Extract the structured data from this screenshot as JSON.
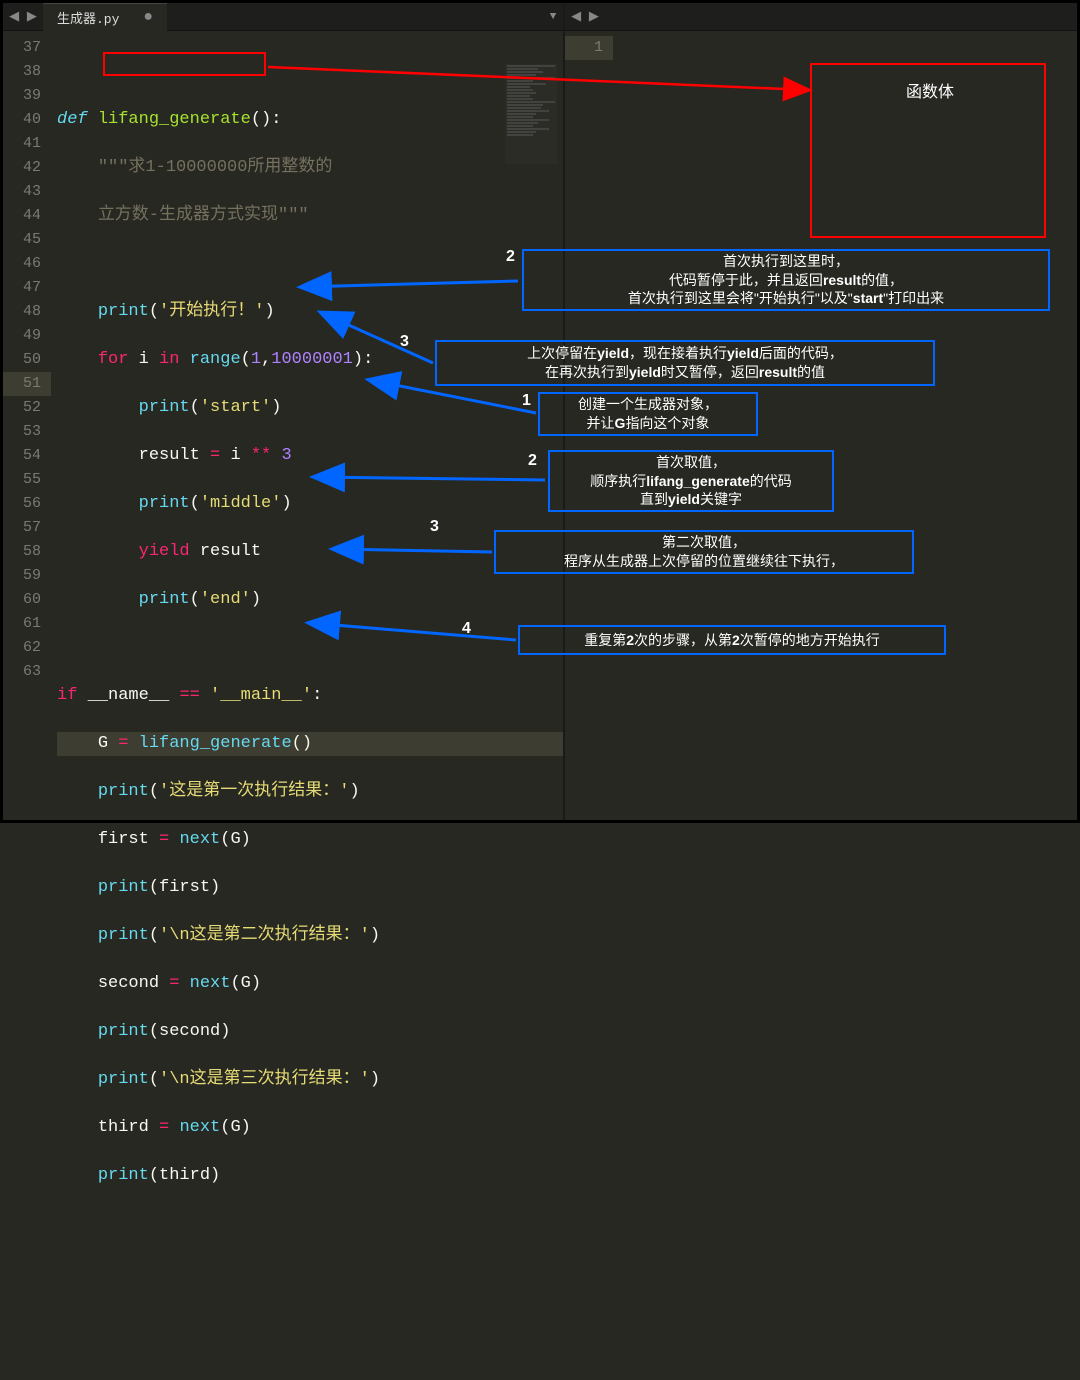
{
  "tab": {
    "name": "生成器.py",
    "dirty": "●"
  },
  "right_pane": {
    "line1": "1"
  },
  "gutter_lines": [
    "37",
    "38",
    "39",
    "40",
    "41",
    "42",
    "43",
    "44",
    "45",
    "46",
    "47",
    "48",
    "49",
    "50",
    "51",
    "52",
    "53",
    "54",
    "55",
    "56",
    "57",
    "58",
    "59",
    "60",
    "61",
    "62",
    "63"
  ],
  "highlight_line": "51",
  "code": {
    "l37": "",
    "l38": {
      "def": "def",
      "sp": " ",
      "fn": "lifang_generate",
      "paren": "():"
    },
    "l39": {
      "indent": "    ",
      "s": "\"\"\"求1-10000000所用整数的"
    },
    "l40": {
      "indent": "    ",
      "s": "立方数-生成器方式实现\"\"\""
    },
    "l41": "",
    "l42": {
      "indent": "    ",
      "p": "print",
      "op": "(",
      "s": "'开始执行！'",
      "cp": ")"
    },
    "l43": {
      "indent": "    ",
      "for": "for",
      "v": " i ",
      "in": "in",
      "sp": " ",
      "r": "range",
      "args": "(",
      "n1": "1",
      "c": ",",
      "n2": "10000001",
      "cp": "):"
    },
    "l44": {
      "indent": "        ",
      "p": "print",
      "op": "(",
      "s": "'start'",
      "cp": ")"
    },
    "l45": {
      "indent": "        ",
      "v": "result ",
      "eq": "=",
      "sp": " i ",
      "op": "**",
      "sp2": " ",
      "n": "3"
    },
    "l46": {
      "indent": "        ",
      "p": "print",
      "op": "(",
      "s": "'middle'",
      "cp": ")"
    },
    "l47": {
      "indent": "        ",
      "y": "yield",
      "v": " result"
    },
    "l48": {
      "indent": "        ",
      "p": "print",
      "op": "(",
      "s": "'end'",
      "cp": ")"
    },
    "l49": "",
    "l50": {
      "if": "if",
      "v": " __name__ ",
      "eq": "==",
      "sp": " ",
      "s": "'__main__'",
      "c": ":"
    },
    "l51": {
      "indent": "    ",
      "v": "G ",
      "eq": "=",
      "sp": " ",
      "fn": "lifang_generate",
      "p": "()"
    },
    "l52": {
      "indent": "    ",
      "p": "print",
      "op": "(",
      "s": "'这是第一次执行结果：'",
      "cp": ")"
    },
    "l53": {
      "indent": "    ",
      "v": "first ",
      "eq": "=",
      "sp": " ",
      "fn": "next",
      "p": "(G)"
    },
    "l54": {
      "indent": "    ",
      "p": "print",
      "op": "(",
      "v": "first",
      "cp": ")"
    },
    "l55": {
      "indent": "    ",
      "p": "print",
      "op": "(",
      "s": "'\\n这是第二次执行结果：'",
      "cp": ")"
    },
    "l56": {
      "indent": "    ",
      "v": "second ",
      "eq": "=",
      "sp": " ",
      "fn": "next",
      "p": "(G)"
    },
    "l57": {
      "indent": "    ",
      "p": "print",
      "op": "(",
      "v": "second",
      "cp": ")"
    },
    "l58": {
      "indent": "    ",
      "p": "print",
      "op": "(",
      "s": "'\\n这是第三次执行结果：'",
      "cp": ")"
    },
    "l59": {
      "indent": "    ",
      "v": "third ",
      "eq": "=",
      "sp": " ",
      "fn": "next",
      "p": "(G)"
    },
    "l60": {
      "indent": "    ",
      "p": "print",
      "op": "(",
      "v": "third",
      "cp": ")"
    }
  },
  "annotations": {
    "fn_body_label": "函数体",
    "box2": {
      "l1": "首次执行到这里时，",
      "l2_a": "代码暂停于此，并且返回",
      "l2_b": "result",
      "l2_c": "的值，",
      "l3_a": "首次执行到这里会将\"开始执行\"以及\"",
      "l3_b": "start",
      "l3_c": "\"打印出来"
    },
    "box3a": {
      "l1_a": "上次停留在",
      "l1_b": "yield",
      "l1_c": "，现在接着执行",
      "l1_d": "yield",
      "l1_e": "后面的代码，",
      "l2_a": "在再次执行到",
      "l2_b": "yield",
      "l2_c": "时又暂停，返回",
      "l2_d": "result",
      "l2_e": "的值"
    },
    "box1": {
      "l1": "创建一个生成器对象，",
      "l2_a": "并让",
      "l2_b": "G",
      "l2_c": "指向这个对象"
    },
    "box2b": {
      "l1": "首次取值，",
      "l2_a": "顺序执行",
      "l2_b": "lifang_generate",
      "l2_c": "的代码",
      "l3_a": "直到",
      "l3_b": "yield",
      "l3_c": "关键字"
    },
    "box3b": {
      "l1": "第二次取值，",
      "l2": "程序从生成器上次停留的位置继续往下执行，"
    },
    "box4": {
      "l1_a": "重复第",
      "l1_b": "2",
      "l1_c": "次的步骤，从第",
      "l1_d": "2",
      "l1_e": "次暂停的地方开始执行"
    },
    "badges": {
      "n1": "1",
      "n2a": "2",
      "n2b": "2",
      "n3a": "3",
      "n3b": "3",
      "n4": "4"
    }
  }
}
